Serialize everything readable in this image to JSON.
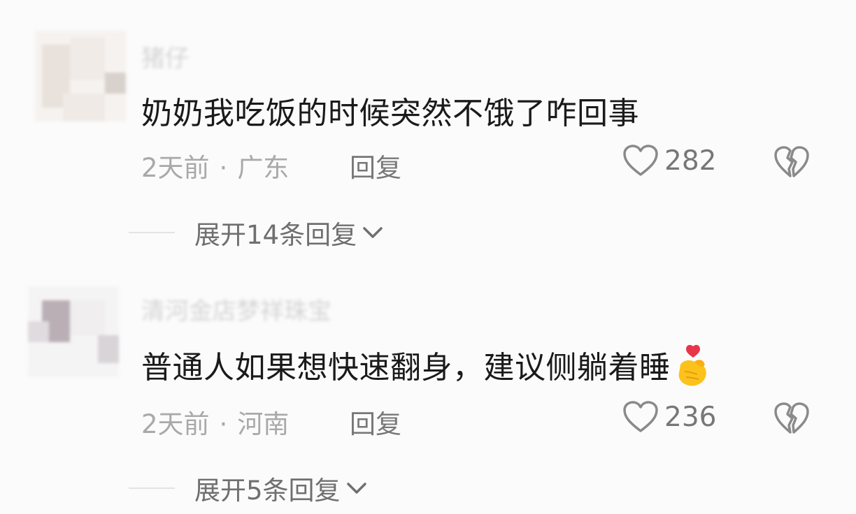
{
  "comments": [
    {
      "username": "猪仔",
      "content": "奶奶我吃饭的时候突然不饿了咋回事",
      "time": "2天前",
      "separator": "·",
      "location": "广东",
      "reply_label": "回复",
      "likes": "282",
      "expand_label": "展开14条回复",
      "avatar_colors": [
        "#f2ede9",
        "#e2dad4",
        "#cfc7c2",
        "#ebe6e3",
        "#f5f1ee"
      ]
    },
    {
      "username": "清河金店梦祥珠宝",
      "content": "普通人如果想快速翻身，建议侧躺着睡",
      "emoji_icon": "finger-heart-emoji",
      "time": "2天前",
      "separator": "·",
      "location": "河南",
      "reply_label": "回复",
      "likes": "236",
      "expand_label": "展开5条回复",
      "avatar_colors": [
        "#efedee",
        "#d6d0d4",
        "#b8aeb4",
        "#e6e2e4",
        "#f6f4f5"
      ]
    }
  ],
  "colors": {
    "background": "#fbfbfb",
    "text_primary": "#1a1a1a",
    "text_meta": "#a9a9a9",
    "text_secondary": "#777777",
    "divider": "#e3e3e3"
  },
  "icons": {
    "like": "heart-outline-icon",
    "dislike": "broken-heart-icon",
    "expand": "chevron-down-icon"
  }
}
